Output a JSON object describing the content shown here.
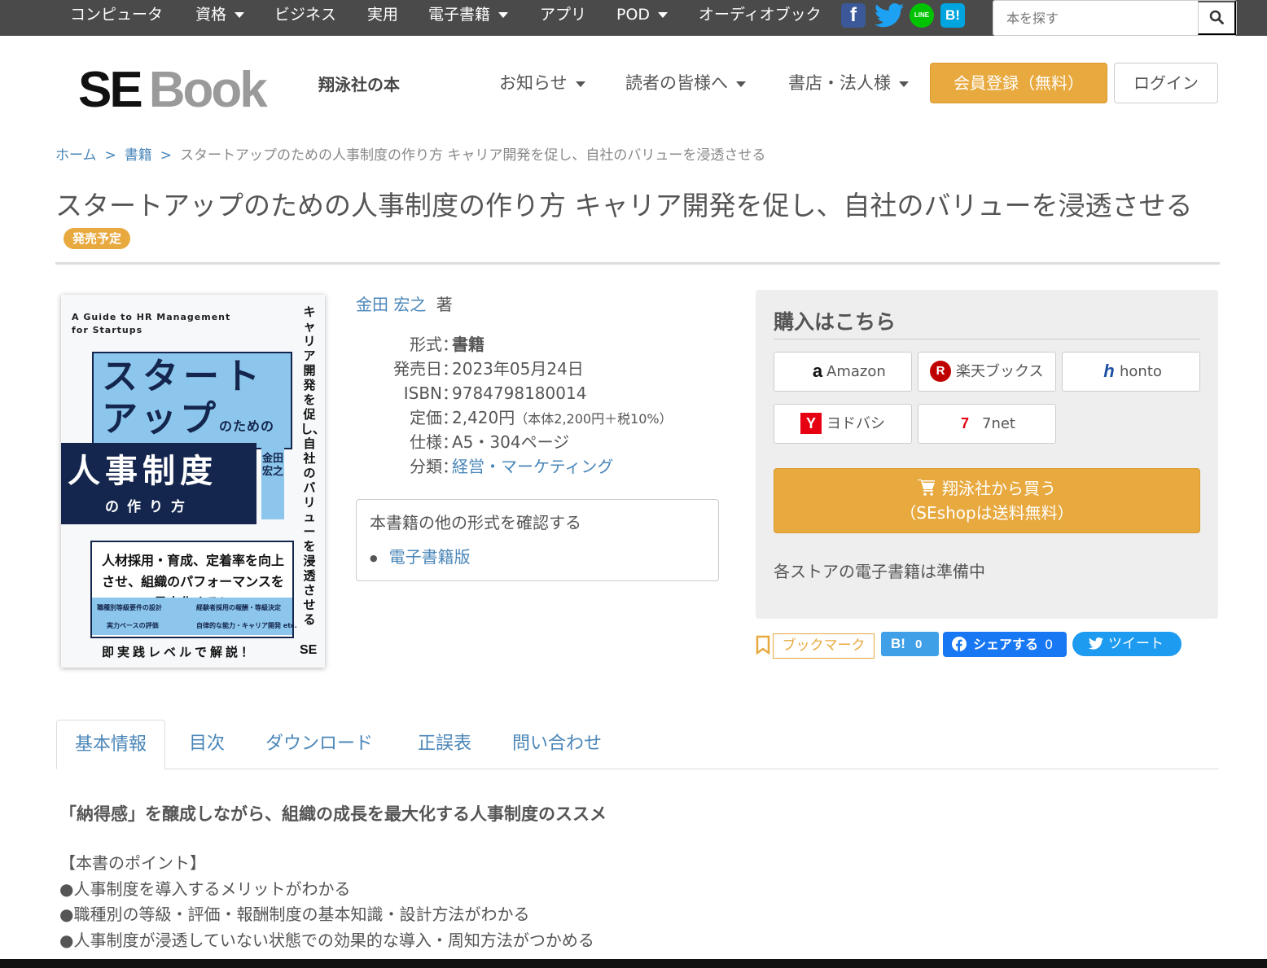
{
  "topbar": {
    "nav": [
      {
        "label": "コンピュータ",
        "dropdown": false
      },
      {
        "label": "資格",
        "dropdown": true
      },
      {
        "label": "ビジネス",
        "dropdown": false
      },
      {
        "label": "実用",
        "dropdown": false
      },
      {
        "label": "電子書籍",
        "dropdown": true
      },
      {
        "label": "アプリ",
        "dropdown": false
      },
      {
        "label": "POD",
        "dropdown": true
      },
      {
        "label": "オーディオブック",
        "dropdown": false
      }
    ],
    "social": [
      {
        "name": "facebook-icon",
        "glyph": "f",
        "color": "#3b5998"
      },
      {
        "name": "twitter-icon",
        "glyph": "",
        "color": "#1da1f2"
      },
      {
        "name": "line-icon",
        "glyph": "LINE",
        "color": "#00c300"
      },
      {
        "name": "hatena-icon",
        "glyph": "B!",
        "color": "#00a4de"
      }
    ],
    "search_placeholder": "本を探す"
  },
  "header": {
    "logo_se": "SE",
    "logo_book": "Book",
    "subtitle": "翔泳社の本",
    "nav": [
      "お知らせ",
      "読者の皆様へ",
      "書店・法人様"
    ],
    "register_label": "会員登録（無料）",
    "login_label": "ログイン"
  },
  "breadcrumb": {
    "home": "ホーム",
    "books": "書籍",
    "current": "スタートアップのための人事制度の作り方 キャリア開発を促し、自社のバリューを浸透させる",
    "separator": ">"
  },
  "book": {
    "title": "スタートアップのための人事制度の作り方 キャリア開発を促し、自社のバリューを浸透させる",
    "status_badge": "発売予定",
    "author": "金田 宏之",
    "author_suffix": "著",
    "details": [
      {
        "label": "形式",
        "value": "書籍",
        "style": "bold",
        "note": ""
      },
      {
        "label": "発売日",
        "value": "2023年05月24日",
        "style": "plain",
        "note": ""
      },
      {
        "label": "ISBN",
        "value": "9784798180014",
        "style": "plain",
        "note": ""
      },
      {
        "label": "定価",
        "value": "2,420円",
        "style": "plain",
        "note": "（本体2,200円＋税10%）"
      },
      {
        "label": "仕様",
        "value": "A5・304ページ",
        "style": "plain",
        "note": ""
      },
      {
        "label": "分類",
        "value": "経営・マーケティング",
        "style": "link",
        "note": ""
      }
    ],
    "detail_colon": "：",
    "other_formats_heading": "本書籍の他の形式を確認する",
    "other_formats": [
      "電子書籍版"
    ]
  },
  "cover": {
    "english_title": "A Guide to HR Management for Startups",
    "vertical_subtitle": "キャリア開発を促し、自社のバリューを浸透させる",
    "title_line1": "スタート",
    "title_line2": "アップ",
    "title_line2_small": "のための",
    "title_line3": "人事制度",
    "title_line4": "の作り方",
    "author": "金田宏之",
    "box_text": "人材採用・育成、定着率を向上させ、組織のパフォーマンスを最大化する！",
    "grid": [
      "職種別等級要件の設計",
      "経験者採用の報酬・等級決定",
      "実力ベースの評価",
      "自律的な能力・キャリア開発 etc."
    ],
    "bottom_text": "即実践レベルで解説！",
    "publisher_mark": "SE"
  },
  "purchase": {
    "heading": "購入はこちら",
    "stores": [
      {
        "name": "Amazon",
        "icon": "a",
        "icon_color": "#111"
      },
      {
        "name": "楽天ブックス",
        "icon": "R",
        "icon_color": "#bf0000"
      },
      {
        "name": "honto",
        "icon": "h",
        "icon_color": "#1e50a2"
      },
      {
        "name": "ヨドバシ",
        "icon": "Y",
        "icon_color": "#e60012"
      },
      {
        "name": "7net",
        "icon": "7",
        "icon_color": "#e60012"
      }
    ],
    "buy_line1": "翔泳社から買う",
    "buy_line2": "（SEshopは送料無料）",
    "ebook_note": "各ストアの電子書籍は準備中"
  },
  "social_share": {
    "bookmark_label": "ブックマーク",
    "hatena_label": "B!",
    "hatena_count": "0",
    "facebook_label": "シェアする",
    "facebook_count": "0",
    "tweet_label": "ツイート"
  },
  "tabs": [
    "基本情報",
    "目次",
    "ダウンロード",
    "正誤表",
    "問い合わせ"
  ],
  "content": {
    "lead": "「納得感」を醸成しながら、組織の成長を最大化する人事制度のススメ",
    "points_heading": "【本書のポイント】",
    "bullet": "●",
    "points": [
      "人事制度を導入するメリットがわかる",
      "職種別の等級・評価・報酬制度の基本知識・設計方法がわかる",
      "人事制度が浸透していない状態での効果的な導入・周知方法がつかめる"
    ]
  },
  "colors": {
    "topbar_bg": "#4a4a4a",
    "accent_orange": "#e8a93f",
    "link_blue": "#4a86b8",
    "cover_navy": "#14264d",
    "cover_light_blue": "#8dc6ec"
  }
}
